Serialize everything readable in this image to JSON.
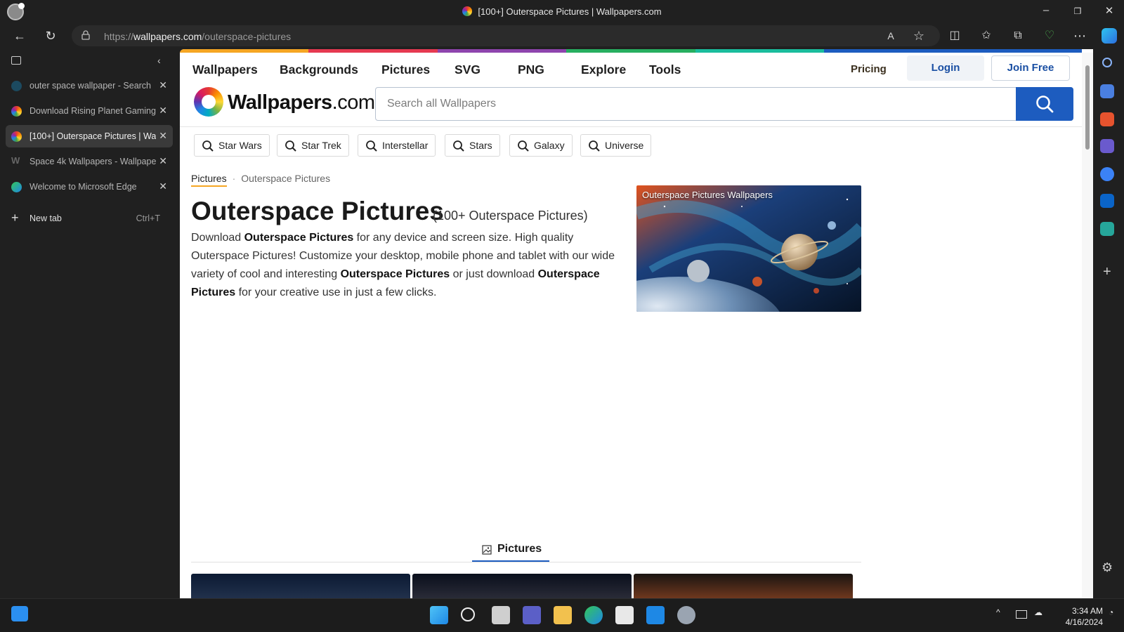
{
  "window": {
    "title": "[100+] Outerspace Pictures | Wallpapers.com"
  },
  "address": {
    "url_prefix": "https://",
    "url_domain": "wallpapers.com",
    "url_path": "/outerspace-pictures"
  },
  "tabs": [
    {
      "label": "outer space wallpaper - Search",
      "icon": "bing-icon",
      "active": false
    },
    {
      "label": "Download Rising Planet Gaming",
      "icon": "wallpapers-favicon",
      "active": false
    },
    {
      "label": "[100+] Outerspace Pictures | Wallpapers.com",
      "icon": "wallpapers-favicon",
      "active": true
    },
    {
      "label": "Space 4k Wallpapers - Wallpaper",
      "icon": "w-favicon",
      "active": false
    },
    {
      "label": "Welcome to Microsoft Edge",
      "icon": "edge-icon",
      "active": false
    }
  ],
  "new_tab": {
    "label": "New tab",
    "shortcut": "Ctrl+T"
  },
  "site": {
    "nav": [
      "Wallpapers",
      "Backgrounds",
      "Pictures",
      "SVG",
      "PNG",
      "Explore",
      "Tools"
    ],
    "pricing": "Pricing",
    "login": "Login",
    "join": "Join Free",
    "logo_bold": "Wallpapers",
    "logo_light": ".com",
    "search_placeholder": "Search all Wallpapers",
    "chips": [
      "Star Wars",
      "Star Trek",
      "Interstellar",
      "Stars",
      "Galaxy",
      "Universe"
    ],
    "breadcrumb": [
      "Pictures",
      "Outerspace Pictures"
    ],
    "heading": "Outerspace Pictures",
    "heading_count": "(100+ Outerspace Pictures)",
    "desc": {
      "p1": "Download ",
      "b1": "Outerspace Pictures",
      "p2": " for any device and screen size. High quality Outerspace Pictures! Customize your desktop, mobile phone and tablet with our wide variety of cool and interesting ",
      "b2": "Outerspace Pictures",
      "p3": " or just download ",
      "b3": "Outerspace Pictures",
      "p4": " for your creative use in just a few clicks."
    },
    "hero_label": "Outerspace Pictures Wallpapers",
    "pictures_tab": "Pictures"
  },
  "taskbar": {
    "time": "3:34 AM",
    "date": "4/16/2024"
  },
  "colors": {
    "accent_blue": "#1d5cbf",
    "color_strip": [
      "#f5a623",
      "#e53950",
      "#8e44ad",
      "#27ae60",
      "#1abc9c",
      "#1d5cbf"
    ]
  }
}
